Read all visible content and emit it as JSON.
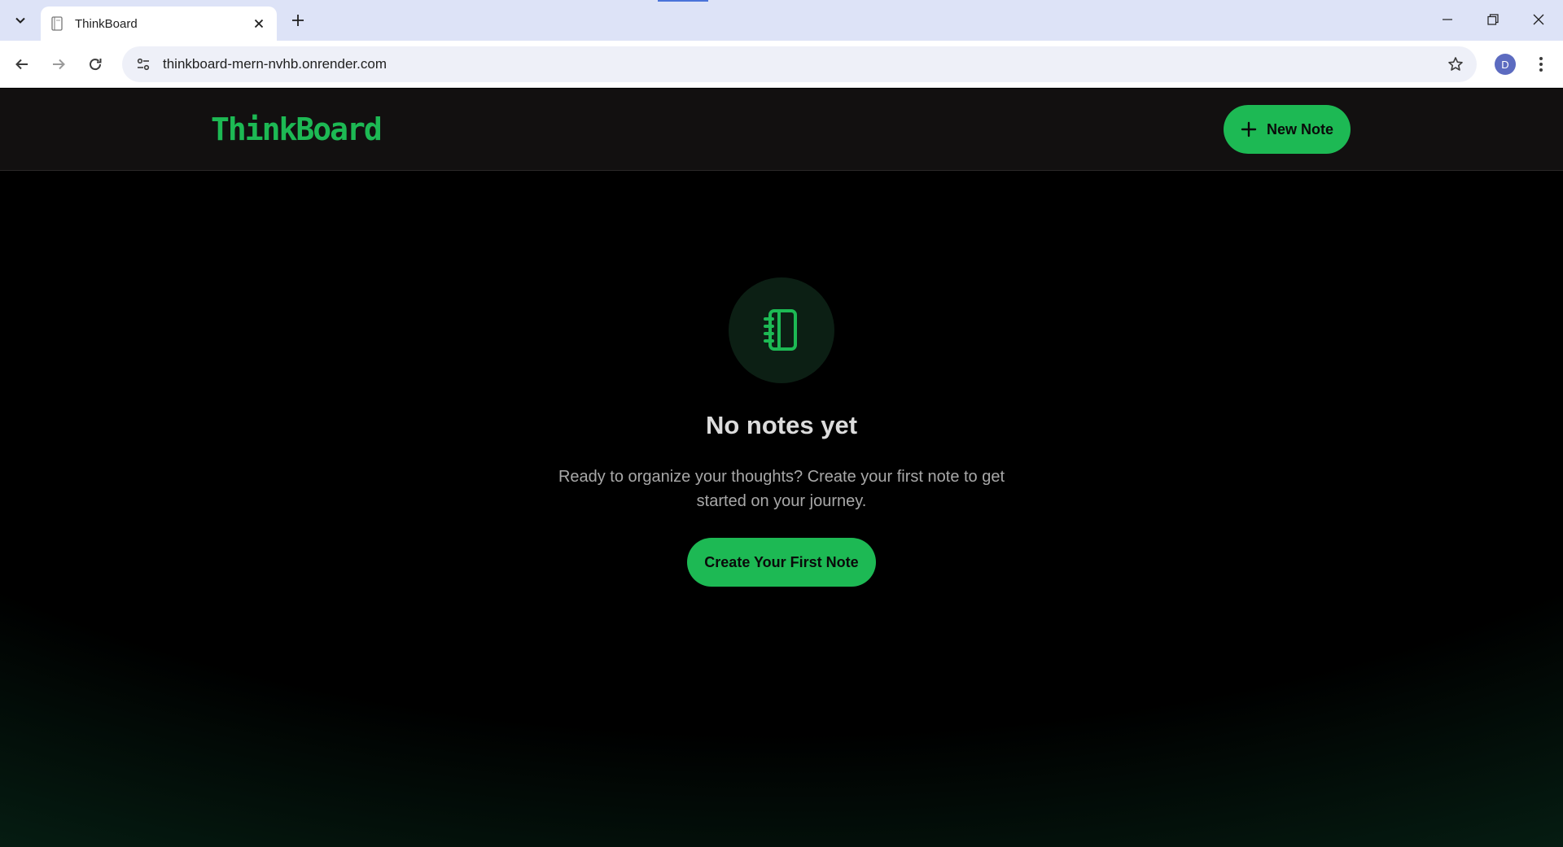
{
  "browser": {
    "tab": {
      "title": "ThinkBoard",
      "favicon": "notebook-icon"
    },
    "url": "thinkboard-mern-nvhb.onrender.com",
    "profile_initial": "D",
    "icons": {
      "tab_search": "chevron-down-icon",
      "tab_close": "close-icon",
      "new_tab": "plus-icon",
      "back": "arrow-left-icon",
      "forward": "arrow-right-icon",
      "reload": "reload-icon",
      "site_info": "tune-icon",
      "bookmark": "star-icon",
      "menu": "more-vertical-icon",
      "minimize": "minimize-icon",
      "restore": "restore-icon",
      "close": "close-icon"
    }
  },
  "app": {
    "brand": "ThinkBoard",
    "header": {
      "new_note_label": "New Note",
      "new_note_icon": "plus-icon"
    },
    "empty_state": {
      "icon": "notebook-icon",
      "title": "No notes yet",
      "description": "Ready to organize your thoughts? Create your first note to get started on your journey.",
      "cta_label": "Create Your First Note"
    },
    "colors": {
      "accent": "#1db954",
      "header_bg": "#121010",
      "page_bg": "#000000"
    }
  }
}
